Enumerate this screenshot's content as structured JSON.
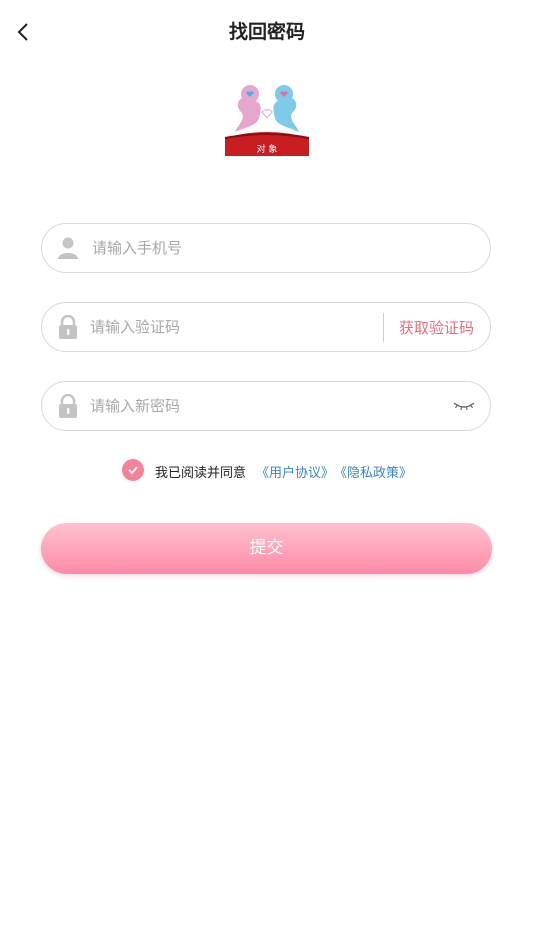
{
  "header": {
    "title": "找回密码",
    "back_icon": "chevron-left-icon"
  },
  "logo": {
    "label": "对 象"
  },
  "form": {
    "phone_placeholder": "请输入手机号",
    "code_placeholder": "请输入验证码",
    "get_code_label": "获取验证码",
    "password_placeholder": "请输入新密码"
  },
  "agreement": {
    "text": "我已阅读并同意",
    "user_agreement": "《用户协议》",
    "privacy_policy": "《隐私政策》",
    "checked": true
  },
  "submit_label": "提交",
  "colors": {
    "accent_pink": "#f38397",
    "link_blue": "#3a85c9",
    "get_code_red": "#f06c7e"
  }
}
